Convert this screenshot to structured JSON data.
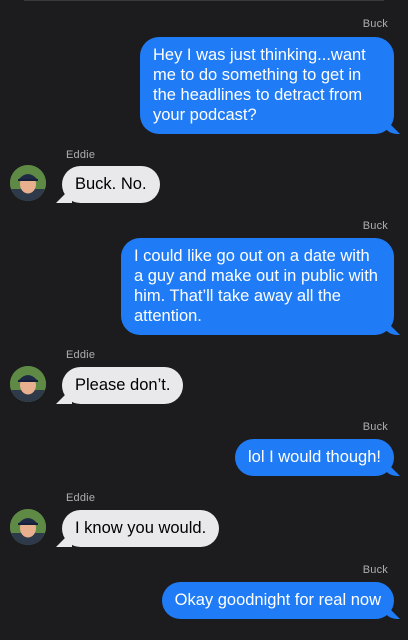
{
  "contacts": {
    "me": "Buck",
    "them": "Eddie"
  },
  "messages": [
    {
      "sender": "Buck",
      "text": "Hey I was just thinking...want me to do something to get in the headlines to detract from your podcast?"
    },
    {
      "sender": "Eddie",
      "text": "Buck. No."
    },
    {
      "sender": "Buck",
      "text": "I could like go out on a date with a guy and make out in public with him. That’ll take away all the attention."
    },
    {
      "sender": "Eddie",
      "text": "Please don’t."
    },
    {
      "sender": "Buck",
      "text": "lol I would though!"
    },
    {
      "sender": "Eddie",
      "text": "I know you would."
    },
    {
      "sender": "Buck",
      "text": "Okay goodnight for real now"
    }
  ],
  "colors": {
    "background": "#1c1c1e",
    "outgoing_bubble": "#1f7cf6",
    "incoming_bubble": "#e9e9eb",
    "sender_label": "#aeaeb2"
  },
  "icons": {
    "avatar": "eddie-avatar-photo"
  }
}
